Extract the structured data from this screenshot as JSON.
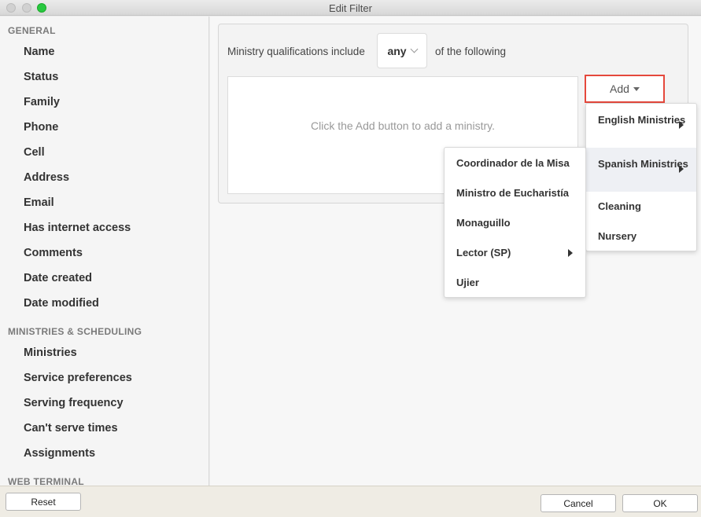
{
  "window": {
    "title": "Edit Filter"
  },
  "sidebar": {
    "sections": [
      {
        "header": "GENERAL",
        "items": [
          "Name",
          "Status",
          "Family",
          "Phone",
          "Cell",
          "Address",
          "Email",
          "Has internet access",
          "Comments",
          "Date created",
          "Date modified"
        ]
      },
      {
        "header": "MINISTRIES & SCHEDULING",
        "items": [
          "Ministries",
          "Service preferences",
          "Serving frequency",
          "Can't serve times",
          "Assignments"
        ]
      },
      {
        "header": "WEB TERMINAL",
        "items": []
      }
    ]
  },
  "filter": {
    "label_before": "Ministry qualifications include",
    "match_value": "any",
    "label_after": "of the following",
    "empty_message": "Click the Add button to add a ministry.",
    "add_label": "Add"
  },
  "add_menu": {
    "items": [
      "English Ministries",
      "Spanish Ministries",
      "Cleaning",
      "Nursery"
    ],
    "highlighted": "Spanish Ministries"
  },
  "submenu": {
    "items": [
      "Coordinador de la Misa",
      "Ministro de Eucharistía",
      "Monaguillo",
      "Lector (SP)",
      "Ujier"
    ]
  },
  "footer": {
    "reset_label": "Reset",
    "cancel_label": "Cancel",
    "ok_label": "OK"
  },
  "colors": {
    "add_highlight_border": "#e5483c",
    "zoom_button": "#28c840"
  }
}
